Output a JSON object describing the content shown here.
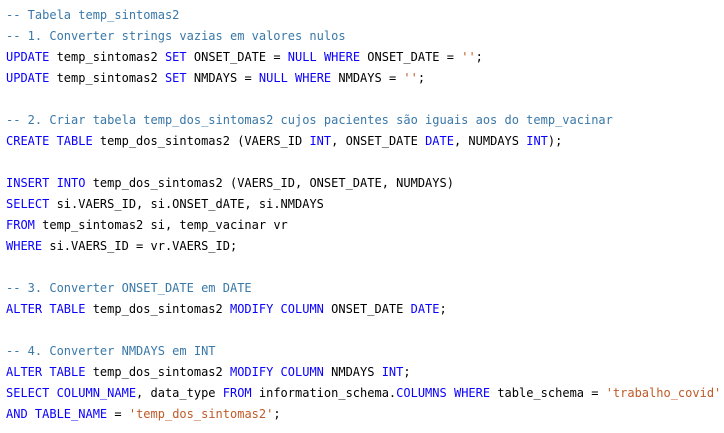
{
  "editor": {
    "colors": {
      "keyword": "#0a00ff",
      "comment": "#3a78a8",
      "string": "#c05a28",
      "text": "#000000",
      "background": "#ffffff"
    },
    "lines": [
      [
        {
          "t": "cm",
          "s": "-- Tabela temp_sintomas2"
        }
      ],
      [
        {
          "t": "cm",
          "s": "-- 1. Converter strings vazias em valores nulos"
        }
      ],
      [
        {
          "t": "kw",
          "s": "UPDATE"
        },
        {
          "t": "tx",
          "s": " temp_sintomas2 "
        },
        {
          "t": "kw",
          "s": "SET"
        },
        {
          "t": "tx",
          "s": " ONSET_DATE = "
        },
        {
          "t": "kw",
          "s": "NULL"
        },
        {
          "t": "tx",
          "s": " "
        },
        {
          "t": "kw",
          "s": "WHERE"
        },
        {
          "t": "tx",
          "s": " ONSET_DATE = "
        },
        {
          "t": "st",
          "s": "''"
        },
        {
          "t": "tx",
          "s": ";"
        }
      ],
      [
        {
          "t": "kw",
          "s": "UPDATE"
        },
        {
          "t": "tx",
          "s": " temp_sintomas2 "
        },
        {
          "t": "kw",
          "s": "SET"
        },
        {
          "t": "tx",
          "s": " NMDAYS = "
        },
        {
          "t": "kw",
          "s": "NULL"
        },
        {
          "t": "tx",
          "s": " "
        },
        {
          "t": "kw",
          "s": "WHERE"
        },
        {
          "t": "tx",
          "s": " NMDAYS = "
        },
        {
          "t": "st",
          "s": "''"
        },
        {
          "t": "tx",
          "s": ";"
        }
      ],
      [],
      [
        {
          "t": "cm",
          "s": "-- 2. Criar tabela temp_dos_sintomas2 cujos pacientes são iguais aos do temp_vacinar"
        }
      ],
      [
        {
          "t": "kw",
          "s": "CREATE TABLE"
        },
        {
          "t": "tx",
          "s": " temp_dos_sintomas2 (VAERS_ID "
        },
        {
          "t": "kw",
          "s": "INT"
        },
        {
          "t": "tx",
          "s": ", ONSET_DATE "
        },
        {
          "t": "kw",
          "s": "DATE"
        },
        {
          "t": "tx",
          "s": ", NUMDAYS "
        },
        {
          "t": "kw",
          "s": "INT"
        },
        {
          "t": "tx",
          "s": ");"
        }
      ],
      [],
      [
        {
          "t": "kw",
          "s": "INSERT INTO"
        },
        {
          "t": "tx",
          "s": " temp_dos_sintomas2 (VAERS_ID, ONSET_DATE, NUMDAYS)"
        }
      ],
      [
        {
          "t": "kw",
          "s": "SELECT"
        },
        {
          "t": "tx",
          "s": " si.VAERS_ID, si.ONSET_dATE, si.NMDAYS"
        }
      ],
      [
        {
          "t": "kw",
          "s": "FROM"
        },
        {
          "t": "tx",
          "s": " temp_sintomas2 si, temp_vacinar vr"
        }
      ],
      [
        {
          "t": "kw",
          "s": "WHERE"
        },
        {
          "t": "tx",
          "s": " si.VAERS_ID = vr.VAERS_ID;"
        }
      ],
      [],
      [
        {
          "t": "cm",
          "s": "-- 3. Converter ONSET_DATE em DATE"
        }
      ],
      [
        {
          "t": "kw",
          "s": "ALTER TABLE"
        },
        {
          "t": "tx",
          "s": " temp_dos_sintomas2 "
        },
        {
          "t": "kw",
          "s": "MODIFY COLUMN"
        },
        {
          "t": "tx",
          "s": " ONSET_DATE "
        },
        {
          "t": "kw",
          "s": "DATE"
        },
        {
          "t": "tx",
          "s": ";"
        }
      ],
      [],
      [
        {
          "t": "cm",
          "s": "-- 4. Converter NMDAYS em INT"
        }
      ],
      [
        {
          "t": "kw",
          "s": "ALTER TABLE"
        },
        {
          "t": "tx",
          "s": " temp_dos_sintomas2 "
        },
        {
          "t": "kw",
          "s": "MODIFY COLUMN"
        },
        {
          "t": "tx",
          "s": " NMDAYS "
        },
        {
          "t": "kw",
          "s": "INT"
        },
        {
          "t": "tx",
          "s": ";"
        }
      ],
      [
        {
          "t": "kw",
          "s": "SELECT COLUMN_NAME"
        },
        {
          "t": "tx",
          "s": ", data_type "
        },
        {
          "t": "kw",
          "s": "FROM"
        },
        {
          "t": "tx",
          "s": " information_schema."
        },
        {
          "t": "kw",
          "s": "COLUMNS"
        },
        {
          "t": "tx",
          "s": " "
        },
        {
          "t": "kw",
          "s": "WHERE"
        },
        {
          "t": "tx",
          "s": " table_schema = "
        },
        {
          "t": "st",
          "s": "'trabalho_covid'"
        }
      ],
      [
        {
          "t": "kw",
          "s": "AND TABLE_NAME"
        },
        {
          "t": "tx",
          "s": " = "
        },
        {
          "t": "st",
          "s": "'temp_dos_sintomas2'"
        },
        {
          "t": "tx",
          "s": ";"
        }
      ]
    ]
  }
}
